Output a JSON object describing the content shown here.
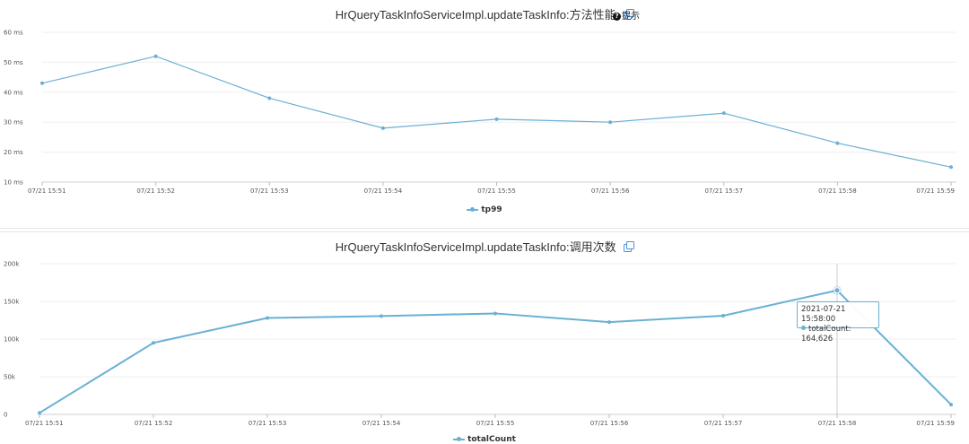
{
  "chart_data": [
    {
      "type": "line",
      "title": "HrQueryTaskInfoServiceImpl.updateTaskInfo:方法性能",
      "hint_label": "提示",
      "categories": [
        "07/21 15:51",
        "07/21 15:52",
        "07/21 15:53",
        "07/21 15:54",
        "07/21 15:55",
        "07/21 15:56",
        "07/21 15:57",
        "07/21 15:58",
        "07/21 15:59"
      ],
      "series": [
        {
          "name": "tp99",
          "values": [
            43,
            52,
            38,
            28,
            31,
            30,
            33,
            23,
            15
          ]
        }
      ],
      "yticks": [
        "10 ms",
        "20 ms",
        "30 ms",
        "40 ms",
        "50 ms",
        "60 ms"
      ],
      "ylim": [
        10,
        60
      ],
      "grid": true,
      "legend_position": "bottom",
      "color": "#6ab0d4"
    },
    {
      "type": "line",
      "title": "HrQueryTaskInfoServiceImpl.updateTaskInfo:调用次数",
      "categories": [
        "07/21 15:51",
        "07/21 15:52",
        "07/21 15:53",
        "07/21 15:54",
        "07/21 15:55",
        "07/21 15:56",
        "07/21 15:57",
        "07/21 15:58",
        "07/21 15:59"
      ],
      "series": [
        {
          "name": "totalCount",
          "values": [
            2000,
            95000,
            128000,
            130500,
            134000,
            122500,
            131000,
            164626,
            13000
          ]
        }
      ],
      "yticks": [
        "0",
        "50k",
        "100k",
        "150k",
        "200k"
      ],
      "ylim": [
        0,
        200000
      ],
      "grid": true,
      "legend_position": "bottom",
      "color": "#6ab0d4",
      "tooltip": {
        "index": 7,
        "time": "2021-07-21 15:58:00",
        "label": "totalCount: 164,626"
      }
    }
  ]
}
